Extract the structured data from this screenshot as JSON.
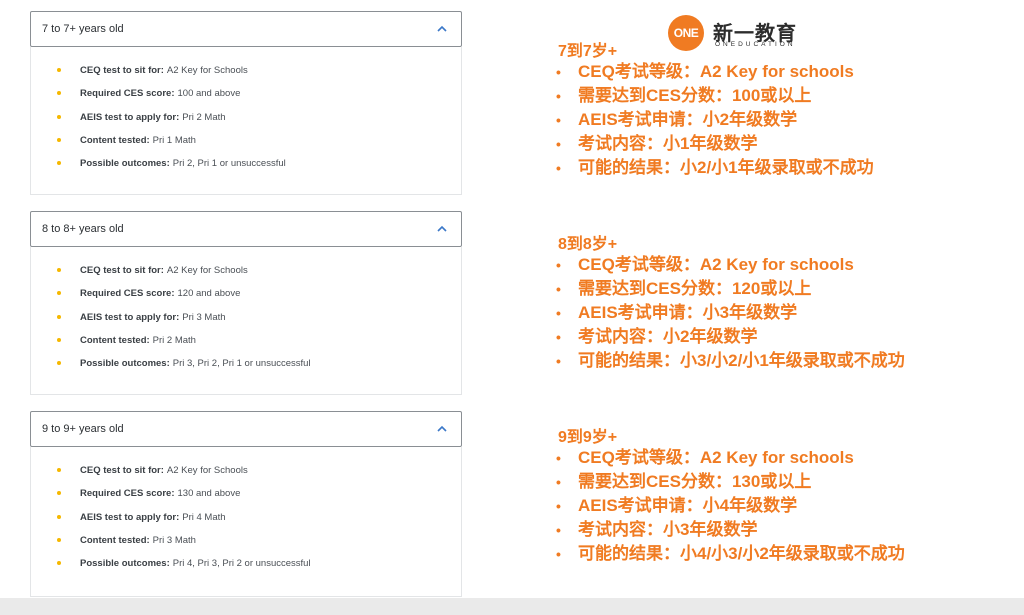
{
  "accordions": [
    {
      "title": "7 to 7+ years old",
      "items": [
        {
          "label": "CEQ test to sit for:",
          "value": "A2 Key for Schools"
        },
        {
          "label": "Required CES score:",
          "value": "100 and above"
        },
        {
          "label": "AEIS test to apply for:",
          "value": "Pri 2 Math"
        },
        {
          "label": "Content tested:",
          "value": "Pri 1 Math"
        },
        {
          "label": "Possible outcomes:",
          "value": "Pri 2, Pri 1 or unsuccessful"
        }
      ]
    },
    {
      "title": "8 to 8+ years old",
      "items": [
        {
          "label": "CEQ test to sit for:",
          "value": "A2 Key for Schools"
        },
        {
          "label": "Required CES score:",
          "value": "120 and above"
        },
        {
          "label": "AEIS test to apply for:",
          "value": "Pri 3 Math"
        },
        {
          "label": "Content tested:",
          "value": "Pri 2 Math"
        },
        {
          "label": "Possible outcomes:",
          "value": "Pri 3, Pri 2, Pri 1 or unsuccessful"
        }
      ]
    },
    {
      "title": "9 to 9+ years old",
      "items": [
        {
          "label": "CEQ test to sit for:",
          "value": "A2 Key for Schools"
        },
        {
          "label": "Required CES score:",
          "value": "130 and above"
        },
        {
          "label": "AEIS test to apply for:",
          "value": "Pri 4 Math"
        },
        {
          "label": "Content tested:",
          "value": "Pri 3 Math"
        },
        {
          "label": "Possible outcomes:",
          "value": "Pri 4, Pri 3, Pri 2 or unsuccessful"
        }
      ]
    }
  ],
  "logo": {
    "badge": "ONE",
    "name_cn": "新一教育",
    "name_en": "ONEDUCATION"
  },
  "translations": [
    {
      "title": "7到7岁+",
      "lines": [
        "CEQ考试等级：A2 Key for schools",
        "需要达到CES分数：100或以上",
        "AEIS考试申请：小2年级数学",
        "考试内容：小1年级数学",
        "可能的结果：小2/小1年级录取或不成功"
      ]
    },
    {
      "title": "8到8岁+",
      "lines": [
        "CEQ考试等级：A2 Key for schools",
        "需要达到CES分数：120或以上",
        "AEIS考试申请：小3年级数学",
        "考试内容：小2年级数学",
        "可能的结果：小3/小2/小1年级录取或不成功"
      ]
    },
    {
      "title": "9到9岁+",
      "lines": [
        "CEQ考试等级：A2 Key for schools",
        "需要达到CES分数：130或以上",
        "AEIS考试申请：小4年级数学",
        "考试内容：小3年级数学",
        "可能的结果：小4/小3/小2年级录取或不成功"
      ]
    }
  ],
  "colors": {
    "accent_orange": "#f07b22",
    "bullet_yellow": "#f6b800",
    "chevron_blue": "#3b78c8"
  },
  "icons": {
    "chevron": "chevron-up-icon"
  }
}
